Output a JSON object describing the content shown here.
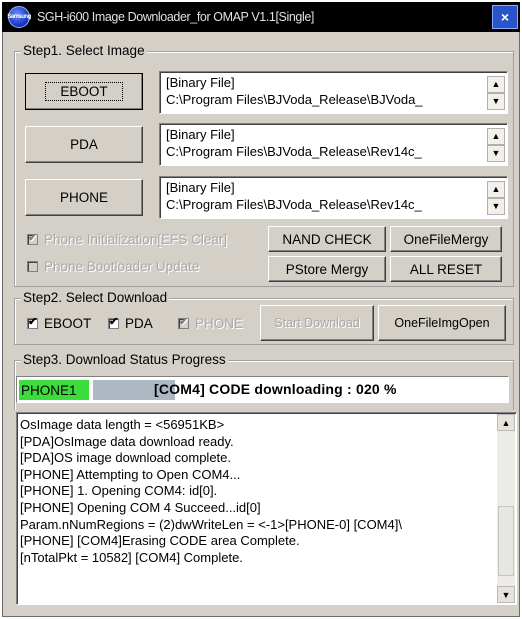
{
  "window": {
    "title": "SGH-i600 Image Downloader_for OMAP V1.1[Single]",
    "app_icon_text": "Samsung",
    "close_symbol": "×"
  },
  "step1": {
    "legend": "Step1. Select Image",
    "rows": [
      {
        "button": "EBOOT",
        "line1": "[Binary File]",
        "line2": "C:\\Program Files\\BJVoda_Release\\BJVoda_"
      },
      {
        "button": "PDA",
        "line1": "[Binary File]",
        "line2": "C:\\Program Files\\BJVoda_Release\\Rev14c_"
      },
      {
        "button": "PHONE",
        "line1": "[Binary File]",
        "line2": "C:\\Program Files\\BJVoda_Release\\Rev14c_"
      }
    ],
    "options": {
      "phone_init": {
        "label": "Phone Initialization[EFS Clear]",
        "checked": true,
        "enabled": false
      },
      "phone_bootloader": {
        "label": "Phone Bootloader Update",
        "checked": false,
        "enabled": false
      }
    },
    "buttons": {
      "nand_check": "NAND CHECK",
      "onefile_mergy": "OneFileMergy",
      "pstore_mergy": "PStore Mergy",
      "all_reset": "ALL RESET"
    }
  },
  "step2": {
    "legend": "Step2. Select Download",
    "checks": {
      "eboot": {
        "label": "EBOOT",
        "checked": true
      },
      "pda": {
        "label": "PDA",
        "checked": true
      },
      "phone": {
        "label": "PHONE",
        "checked": true,
        "enabled": false
      }
    },
    "buttons": {
      "start_download": "Start Download",
      "onefile_img_open": "OneFileImgOpen"
    }
  },
  "step3": {
    "legend": "Step3. Download Status Progress",
    "phone_label": "PHONE1",
    "phone_label_color": "#3bdc3b",
    "progress_percent": 20,
    "status_text": "[COM4] CODE downloading : 020 %"
  },
  "log": {
    "lines": [
      "OsImage data length = <56951KB>",
      "[PDA]OsImage data download ready.",
      "[PDA]OS image download complete.",
      "[PHONE] Attempting to Open COM4...",
      "[PHONE] 1. Opening COM4: id[0].",
      "[PHONE] Opening COM 4 Succeed...id[0]",
      "Param.nNumRegions = (2)dwWriteLen = <-1>[PHONE-0] [COM4]\\",
      "[PHONE] [COM4]Erasing CODE area Complete.",
      "[nTotalPkt = 10582] [COM4] Complete."
    ]
  },
  "icons": {
    "up": "▲",
    "down": "▼",
    "check": "✔"
  }
}
